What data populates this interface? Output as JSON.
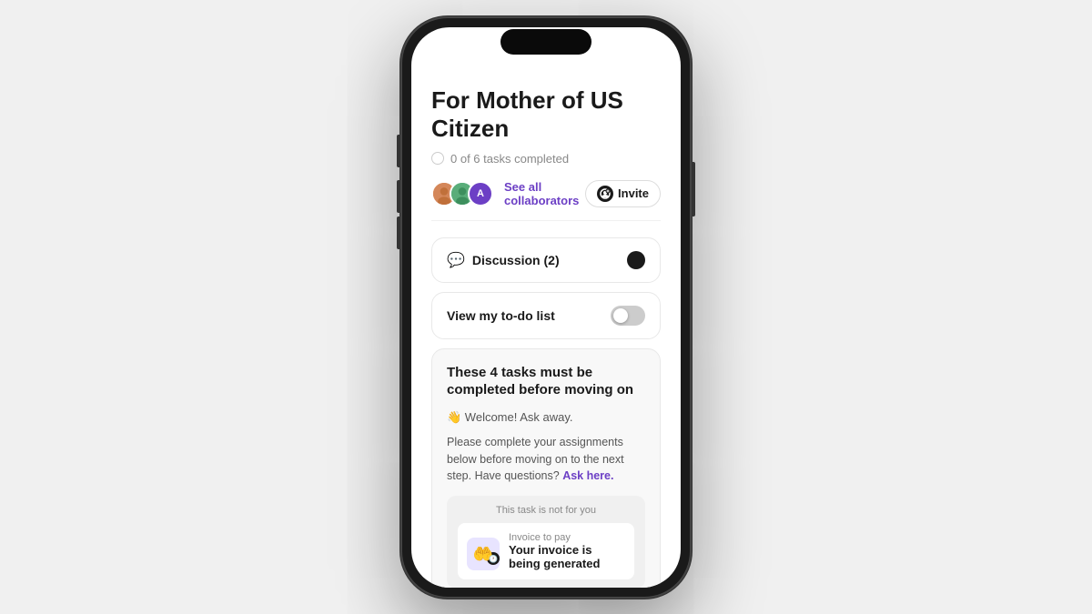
{
  "phone": {
    "screen": {
      "title": "For Mother of US Citizen",
      "progress": {
        "text": "0 of 6 tasks completed"
      },
      "collaborators": {
        "see_all_label": "See all collaborators",
        "invite_label": "Invite",
        "avatars": [
          {
            "id": "avatar-1",
            "initials": ""
          },
          {
            "id": "avatar-2",
            "initials": ""
          },
          {
            "id": "avatar-3",
            "initials": "A"
          }
        ]
      },
      "discussion": {
        "label": "Discussion (2)"
      },
      "todo": {
        "label": "View my to-do list"
      },
      "tasks_block": {
        "heading": "These 4 tasks must be completed before moving on",
        "welcome": "👋 Welcome! Ask away.",
        "description": "Please complete your assignments below before moving on to the next step. Have questions?",
        "ask_link": "Ask here."
      },
      "invoice_card": {
        "not_for_you": "This task is not for you",
        "invoice_label": "Invoice to pay",
        "invoice_title": "Your invoice is being generated"
      }
    }
  }
}
